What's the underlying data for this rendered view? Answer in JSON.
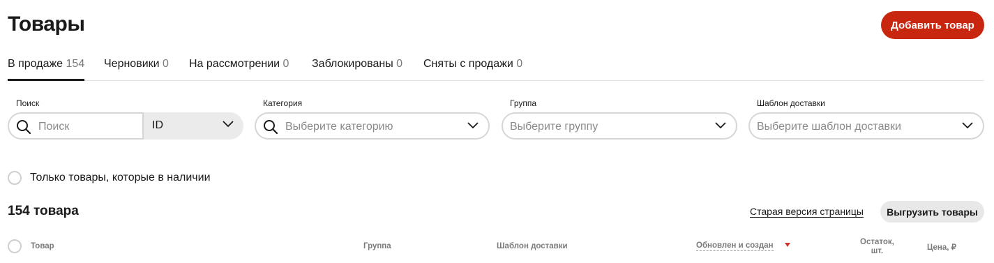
{
  "header": {
    "title": "Товары",
    "add_button": "Добавить товар"
  },
  "tabs": [
    {
      "label": "В продаже",
      "count": "154",
      "active": true
    },
    {
      "label": "Черновики",
      "count": "0"
    },
    {
      "label": "На рассмотрении",
      "count": "0"
    },
    {
      "label": "Заблокированы",
      "count": "0"
    },
    {
      "label": "Сняты с продажи",
      "count": "0"
    }
  ],
  "filters": {
    "search": {
      "label": "Поиск",
      "placeholder": "Поиск",
      "field_select": "ID"
    },
    "category": {
      "label": "Категория",
      "placeholder": "Выберите категорию"
    },
    "group": {
      "label": "Группа",
      "placeholder": "Выберите группу"
    },
    "delivery": {
      "label": "Шаблон доставки",
      "placeholder": "Выберите шаблон доставки"
    }
  },
  "in_stock_only": {
    "label": "Только товары, которые в наличии",
    "checked": false
  },
  "results": {
    "count_title": "154 товара",
    "old_version_link": "Старая версия страницы",
    "export_button": "Выгрузить товары"
  },
  "table": {
    "columns": {
      "product": "Товар",
      "group": "Группа",
      "delivery": "Шаблон доставки",
      "updated": "Обновлен и создан",
      "stock_line1": "Остаток,",
      "stock_line2": "шт.",
      "price": "Цена, ₽"
    },
    "sort": {
      "column": "Обновлен и создан",
      "direction": "desc"
    }
  },
  "colors": {
    "accent": "#c8260f",
    "sort_arrow": "#d0342c"
  }
}
